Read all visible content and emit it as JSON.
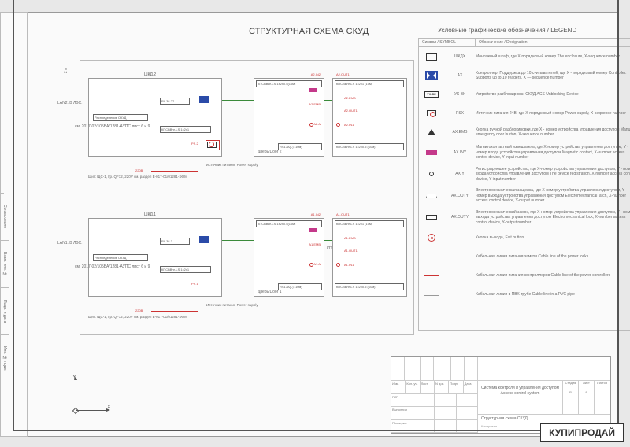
{
  "title": "СТРУКТУРНАЯ СХЕМА СКУД",
  "legend_title": "Условные графические обозначения / LEGEND",
  "legend_header": {
    "symbol": "Символ / SYMBOL",
    "designation": "Обозначение / Designation"
  },
  "legend": [
    {
      "code": "ШКДХ",
      "desc": "Монтажный шкаф, где X-порядковый номер\nThe enclosure, X-sequence number"
    },
    {
      "code": "АХ",
      "desc": "Контроллер. Поддержка до 10 считывателей, где X - порядковый номер\nController. Supports up to 10 readers, X — sequence number"
    },
    {
      "code": "УК-ВК",
      "desc": "Устройство разблокировки СКУД\nACS Unblocking Device"
    },
    {
      "code": "PSX",
      "desc": "Источник питания 24В, где X-порядковый номер\nPower supply, X-sequence number"
    },
    {
      "code": "AX.EMB",
      "desc": "Кнопка ручной разблокировки, где X - номер устройства управления доступом\nManual emergency door button, X-sequence number"
    },
    {
      "code": "AX.INY",
      "desc": "Магнитоконтактный извещатель, где X-номер устройства управления доступом, Y - номер входа устройства управления доступом\nMagnetic contact, X-number access control device, Y-input number"
    },
    {
      "code": "AX.Y",
      "desc": "Регистрирующее устройство, где X-номер устройства управления доступом, Y - номер входа устройства управления доступом\nThe device registration, X-number access control device, Y-input number"
    },
    {
      "code": "AX.OUTY",
      "desc": "Электромеханическая защелка, где X-номер устройства управления доступом, Y - номер выхода устройства управления доступом\nElectromechanical latch, X-number access control device, Y-output number"
    },
    {
      "code": "AX.OUTY",
      "desc": "Электромеханический замок, где X-номер устройства управления доступом, Y - номер выхода устройства управления доступом\nElectromechanical lock, X-number access control device, Y-output number"
    },
    {
      "code": "",
      "desc": "Кнопка выхода, Exit button"
    },
    {
      "code": "",
      "desc": "Кабельная линия питания замков\nCable line of the power locks"
    },
    {
      "code": "",
      "desc": "Кабельная линия питания контроллеров\nCable line of the power controllers"
    },
    {
      "code": "",
      "desc": "Кабельная линия в ПВХ трубе\nCable line in a PVC pipe"
    }
  ],
  "blocks": {
    "top": {
      "label": "ШКД.2",
      "lan": "LAN2: В ЛВС:",
      "rasp": "Распределение СКУД",
      "ref": "см. 2017-02/105БА/1281-АУПС лист 6 и 9",
      "ctrl": "RL 38.27",
      "cable": "КПСВВнг-LS 1x2x1",
      "ps": "PS.2",
      "pwr": "Источник питания\nPower supply",
      "pwr_ref": "Щит: ЩС-1, Гр. QF12, 220V\nсм. раздел Е-017-01/01281-ЭОМ",
      "voltage": "220В"
    },
    "bot": {
      "label": "ШКД.1",
      "lan": "LAN1: В ЛВС:",
      "rasp": "Распределение СКУД",
      "ref": "см. 2017-02/105БА/1281-АУПС лист 6 и 9",
      "ctrl": "RL 38.3",
      "cable": "КПСВВнг-LS 1x2x1",
      "ps": "PS.1",
      "pwr": "Источник питания\nPower supply",
      "pwr_ref": "Щит: ЩС-1, Гр. QF12, 220V\nсм. раздел Е-017-01/01281-ЭОМ",
      "voltage": "220В"
    },
    "doors": {
      "t1": {
        "in": "A2.IN2",
        "cable_in": "КПСВВнг-LS 1x2x0.5(10м)",
        "emb": "A2.EMB",
        "aa": "A2.A",
        "door": "Дверь/Door 2",
        "rs": "RS17A(L) (10м)"
      },
      "t2": {
        "out": "A2.OUT1",
        "cable_out": "КПСВВнг-LS 1x2x1 (10м)",
        "emb": "A2.EMB",
        "out1": "A2.OUT1",
        "in1": "A2.IN1",
        "cable": "КПСВВнг-LS 1x2x0.5 (10м)"
      },
      "b1": {
        "in": "A1.IN2",
        "cable_in": "КПСВВнг-LS 1x2x0.5(10м)",
        "emb": "A1.EMB",
        "aa": "A1.A",
        "door": "Дверь/Door 1",
        "rs": "RS17A(L) (10м)"
      },
      "b2": {
        "out": "A1.OUT1",
        "cable_out": "КПСВВнг-LS 1x2x1 (10м)",
        "emb": "A1.EMB",
        "out1": "A1.OUT1",
        "in1": "A1.IN1",
        "cable": "КПСВВнг-LS 1x2x0.5 (10м)"
      }
    }
  },
  "title_block": {
    "headers": [
      "Изм.",
      "Кол. уч.",
      "Лист",
      "N док.",
      "Подп.",
      "Дата"
    ],
    "rows": [
      "ГИП",
      "Выполнил",
      "Проверил"
    ],
    "desc": "Система контроля и управления доступом\nAccess control system",
    "sheet_name": "Структурная схема СКУД",
    "copy": "Копировал",
    "slr": {
      "s": "Стадия",
      "l": "Лист",
      "n": "Листов",
      "sv": "Р",
      "lv": "8",
      "nv": ""
    }
  },
  "rail": [
    "",
    "Согласовано",
    "Взам. инв. №",
    "Подп. и дата",
    "Инв. № подл."
  ],
  "axis": {
    "x": "X",
    "y": "Y",
    "scale": "2 кг"
  },
  "watermark": "КУПИПРОДАЙ"
}
